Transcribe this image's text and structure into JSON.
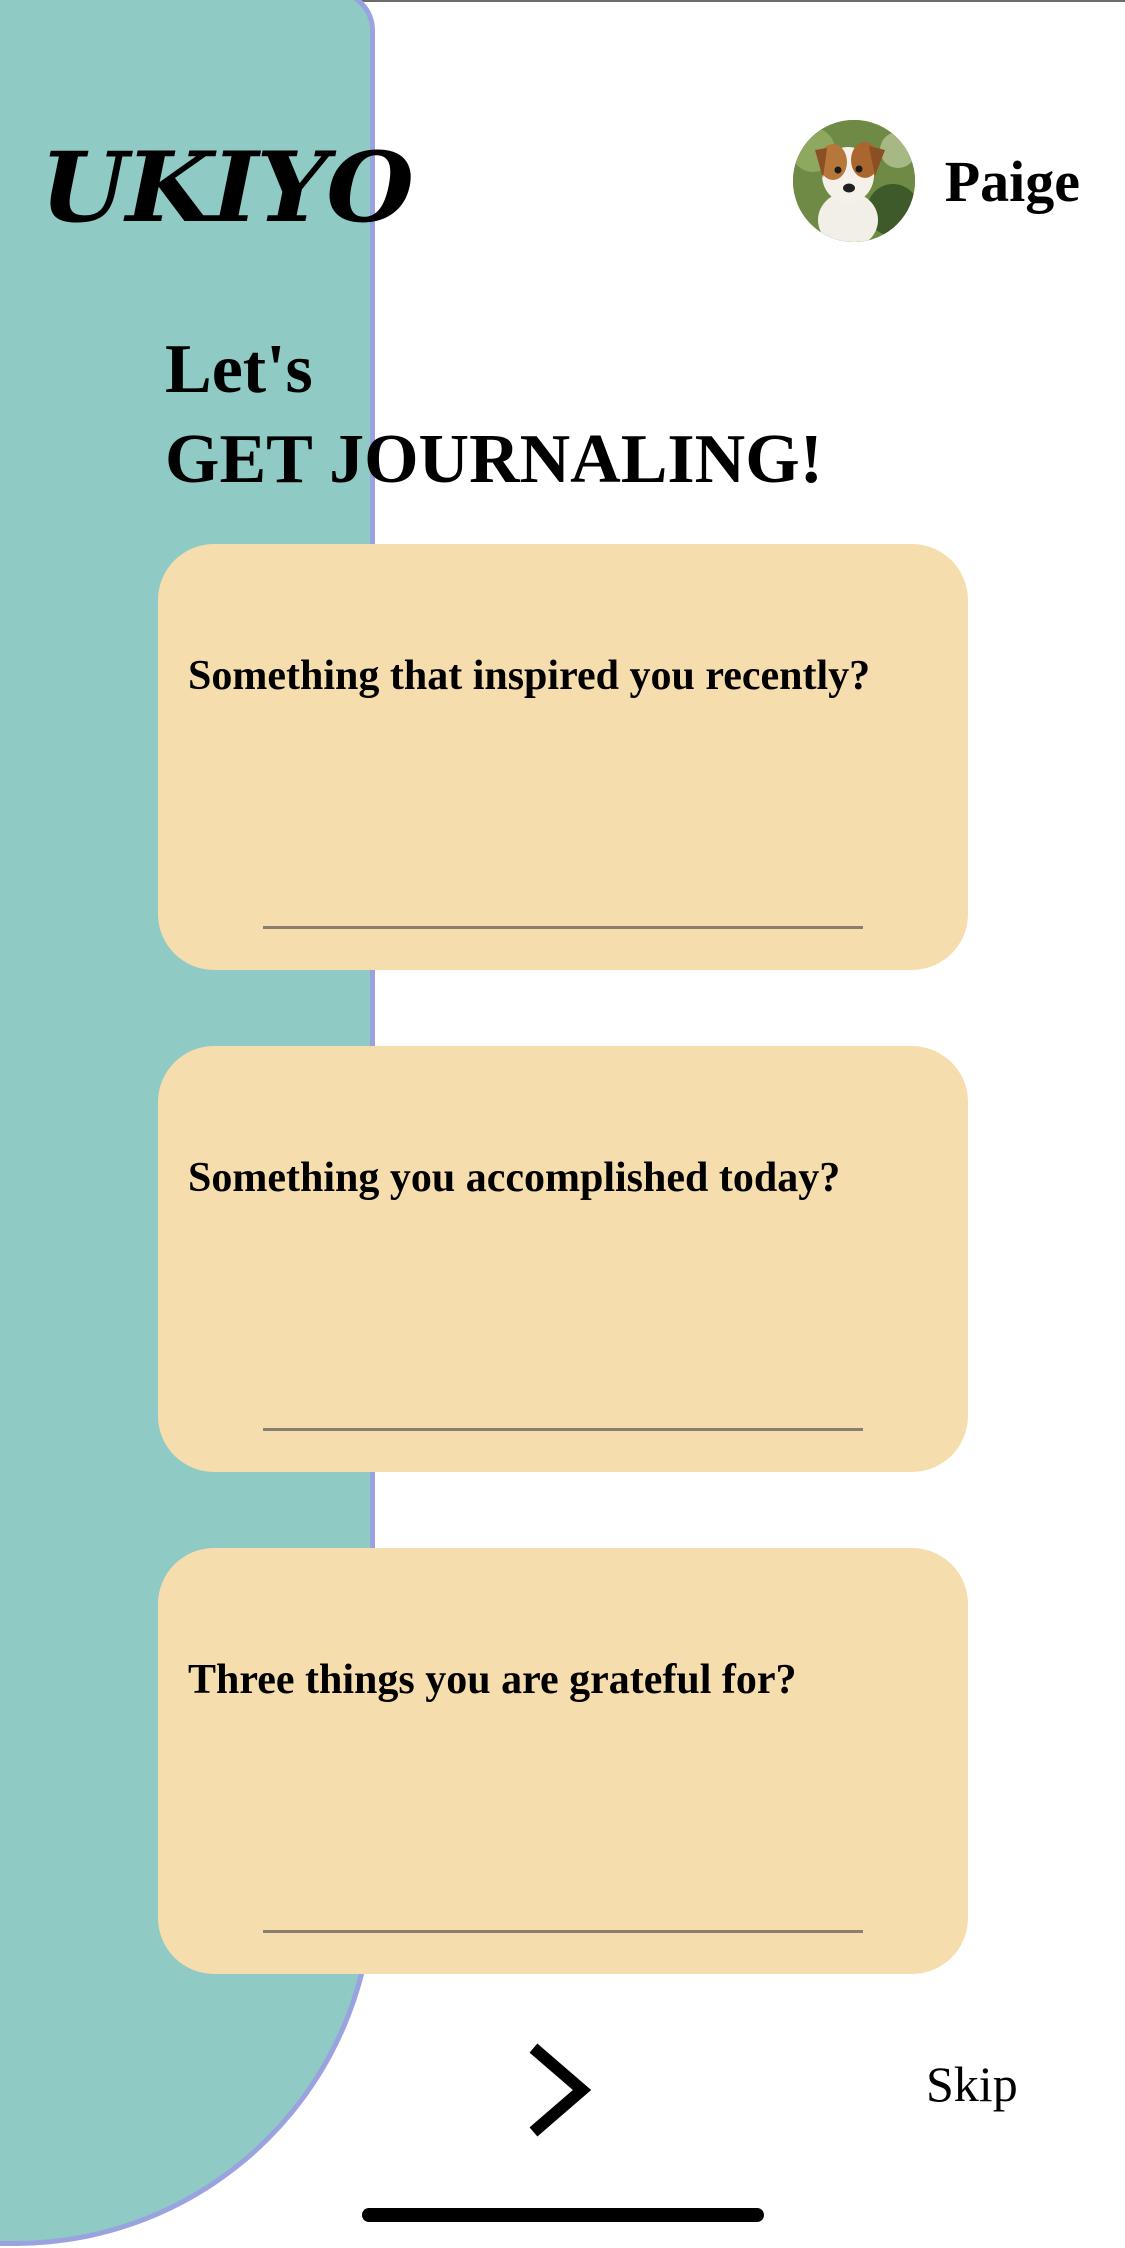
{
  "app": {
    "logo_text": "UKIYO"
  },
  "profile": {
    "user_name": "Paige",
    "avatar_icon": "dog-photo-avatar"
  },
  "heading": {
    "line1": "Let's",
    "line2": "GET JOURNALING!"
  },
  "prompts": [
    {
      "question": "Something that inspired you recently?",
      "answer": ""
    },
    {
      "question": "Something you accomplished today?",
      "answer": ""
    },
    {
      "question": "Three things you are grateful for?",
      "answer": ""
    }
  ],
  "navigation": {
    "next_icon": "chevron-right-icon",
    "skip_label": "Skip"
  },
  "colors": {
    "panel": "#8fcac5",
    "panel_border": "#9aa3e0",
    "card": "#f6ddad",
    "text": "#000000"
  }
}
